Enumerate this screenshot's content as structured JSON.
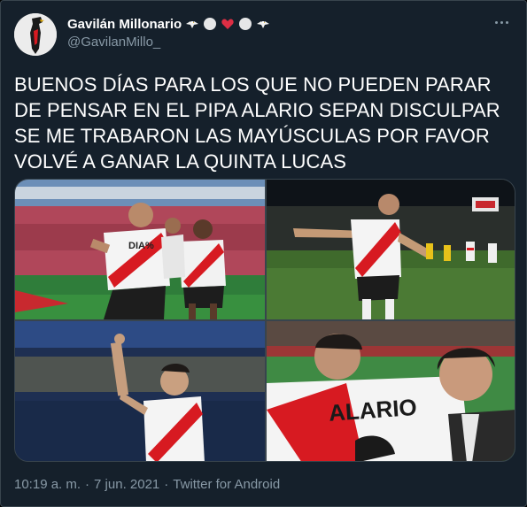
{
  "user": {
    "display_name": "Gavilán Millonario",
    "handle": "@GavilanMillo_",
    "name_emojis": [
      "eagle-emoji",
      "white-circle-emoji",
      "red-heart-emoji",
      "white-circle-emoji",
      "eagle-emoji"
    ]
  },
  "tweet": {
    "text": "BUENOS DÍAS PARA LOS QUE NO PUEDEN PARAR DE PENSAR EN EL PIPA ALARIO SEPAN DISCULPAR SE ME TRABARON LAS MAYÚSCULAS POR FAVOR VOLVÉ A GANAR LA QUINTA LUCAS"
  },
  "photos": [
    {
      "name": "photo-celebration-stadium",
      "jersey_text": "DIA%"
    },
    {
      "name": "photo-celebration-night"
    },
    {
      "name": "photo-pointing-sky"
    },
    {
      "name": "photo-hug-coach",
      "jersey_text": "ALARIO"
    }
  ],
  "meta": {
    "time": "10:19 a. m.",
    "separator1": "·",
    "date": "7 jun. 2021",
    "separator2": "·",
    "source": "Twitter for Android"
  },
  "colors": {
    "background": "#15202b",
    "border": "#38444d",
    "text_primary": "#ffffff",
    "text_secondary": "#8899a6",
    "river_red": "#d71a21"
  }
}
